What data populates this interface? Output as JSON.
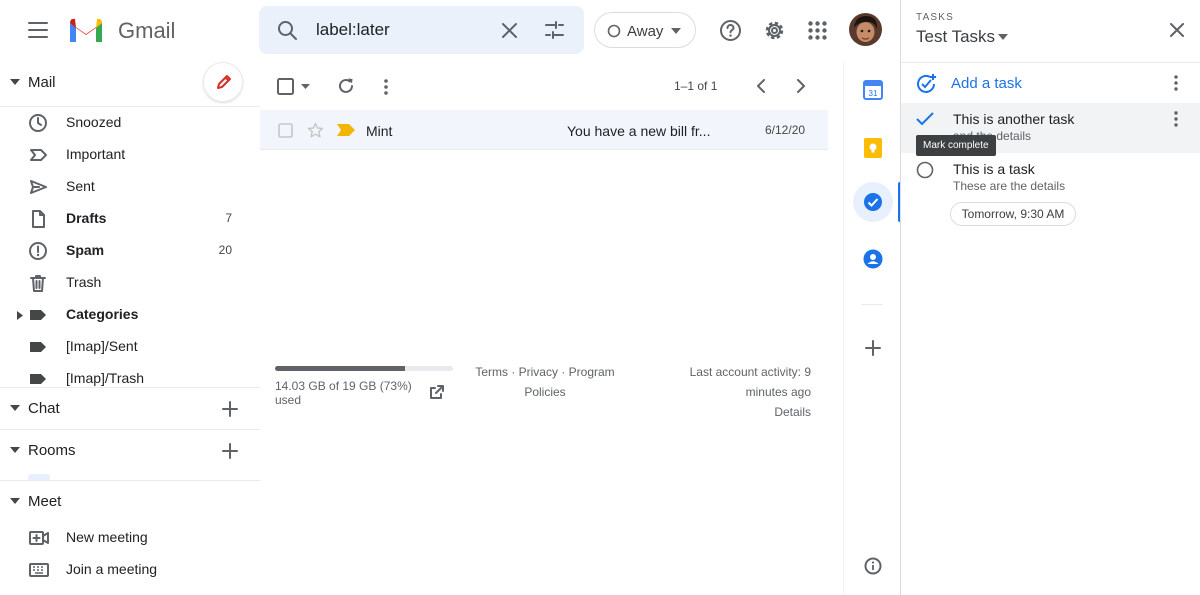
{
  "header": {
    "app_name": "Gmail",
    "search_query": "label:later",
    "status": "Away"
  },
  "nav": {
    "mail_section": "Mail",
    "items": [
      {
        "label": "Snoozed",
        "count": "",
        "icon": "clock-icon"
      },
      {
        "label": "Important",
        "count": "",
        "icon": "important-icon"
      },
      {
        "label": "Sent",
        "count": "",
        "icon": "send-icon"
      },
      {
        "label": "Drafts",
        "count": "7",
        "icon": "draft-icon"
      },
      {
        "label": "Spam",
        "count": "20",
        "icon": "spam-icon"
      },
      {
        "label": "Trash",
        "count": "",
        "icon": "trash-icon"
      },
      {
        "label": "Categories",
        "count": "",
        "icon": "label-icon"
      },
      {
        "label": "[Imap]/Sent",
        "count": "",
        "icon": "label-icon"
      },
      {
        "label": "[Imap]/Trash",
        "count": "",
        "icon": "label-icon"
      }
    ],
    "chat_section": "Chat",
    "rooms_section": "Rooms",
    "meet_section": "Meet",
    "meet_items": [
      {
        "label": "New meeting",
        "icon": "video-icon"
      },
      {
        "label": "Join a meeting",
        "icon": "keyboard-icon"
      }
    ]
  },
  "toolbar": {
    "pagination": "1–1 of 1"
  },
  "email": {
    "sender": "Mint",
    "subject": "You have a new bill fr...",
    "date": "6/12/20"
  },
  "footer": {
    "storage": "14.03 GB of 19 GB (73%) used",
    "storage_fraction": 0.73,
    "links_line1": "Terms · Privacy · Program",
    "links_line2": "Policies",
    "activity_line1": "Last account activity: 9",
    "activity_line2": "minutes ago",
    "details": "Details"
  },
  "tasks": {
    "eyebrow": "TASKS",
    "list_name": "Test Tasks",
    "add_task": "Add a task",
    "items": [
      {
        "title": "This is another task",
        "details": "and the details"
      },
      {
        "title": "This is a task",
        "details": "These are the details",
        "due": "Tomorrow, 9:30 AM"
      }
    ],
    "tooltip": "Mark complete"
  },
  "colors": {
    "accent": "#1a73e8",
    "selected_row": "#f2f6fc",
    "search_bg": "#eaf1fb"
  }
}
